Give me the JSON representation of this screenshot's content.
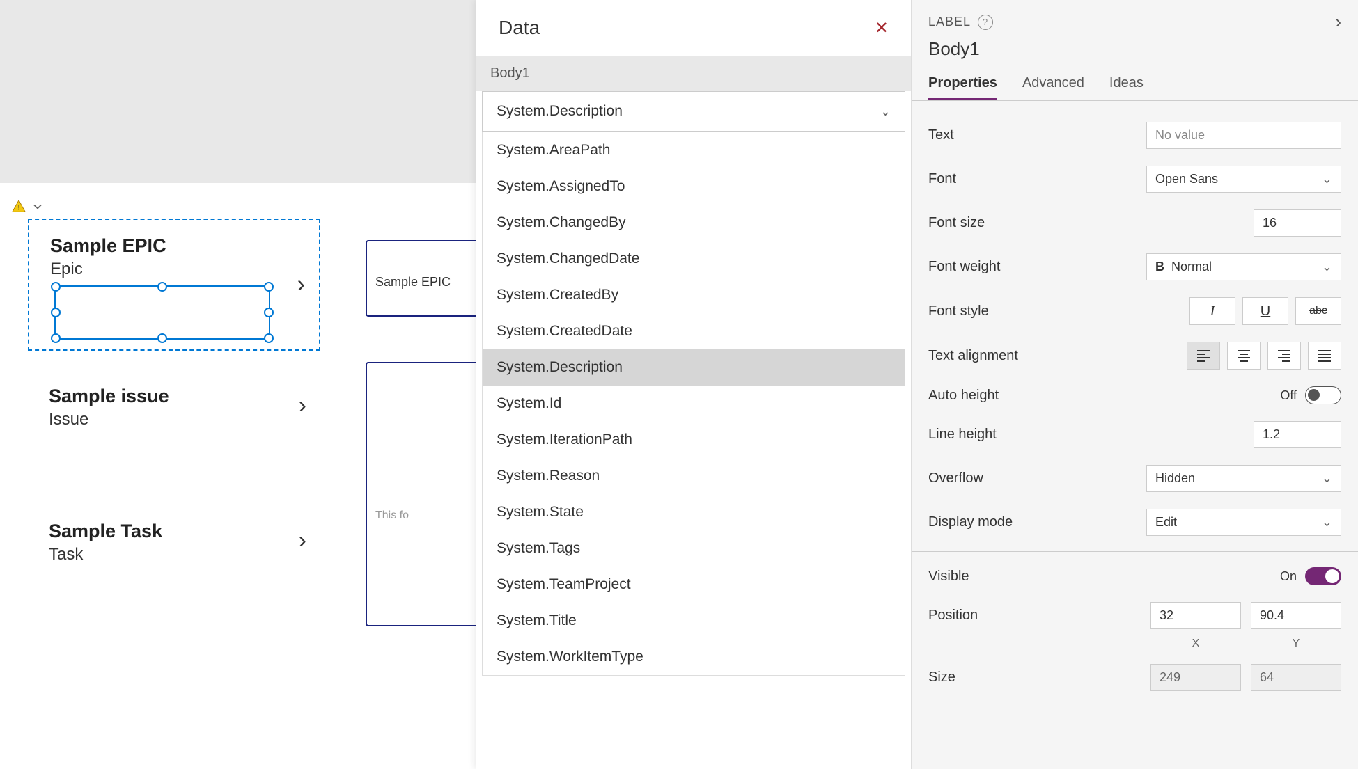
{
  "canvas": {
    "gallery": [
      {
        "title": "Sample EPIC",
        "subtitle": "Epic"
      },
      {
        "title": "Sample issue",
        "subtitle": "Issue"
      },
      {
        "title": "Sample Task",
        "subtitle": "Task"
      }
    ],
    "detail_title": "Sample EPIC",
    "detail_body_hint": "This fo"
  },
  "data_panel": {
    "title": "Data",
    "element_name": "Body1",
    "selected_value": "System.Description",
    "options": [
      "System.AreaPath",
      "System.AssignedTo",
      "System.ChangedBy",
      "System.ChangedDate",
      "System.CreatedBy",
      "System.CreatedDate",
      "System.Description",
      "System.Id",
      "System.IterationPath",
      "System.Reason",
      "System.State",
      "System.Tags",
      "System.TeamProject",
      "System.Title",
      "System.WorkItemType"
    ],
    "highlighted": "System.Description"
  },
  "props": {
    "label_caption": "LABEL",
    "element_name": "Body1",
    "tabs": [
      "Properties",
      "Advanced",
      "Ideas"
    ],
    "active_tab": "Properties",
    "text": {
      "label": "Text",
      "placeholder": "No value",
      "value": ""
    },
    "font": {
      "label": "Font",
      "value": "Open Sans"
    },
    "font_size": {
      "label": "Font size",
      "value": "16"
    },
    "font_weight": {
      "label": "Font weight",
      "value": "Normal"
    },
    "font_style": {
      "label": "Font style"
    },
    "text_alignment": {
      "label": "Text alignment",
      "active": "left"
    },
    "auto_height": {
      "label": "Auto height",
      "value_text": "Off",
      "on": false
    },
    "line_height": {
      "label": "Line height",
      "value": "1.2"
    },
    "overflow": {
      "label": "Overflow",
      "value": "Hidden"
    },
    "display_mode": {
      "label": "Display mode",
      "value": "Edit"
    },
    "visible": {
      "label": "Visible",
      "value_text": "On",
      "on": true
    },
    "position": {
      "label": "Position",
      "x": "32",
      "y": "90.4",
      "x_label": "X",
      "y_label": "Y"
    },
    "size": {
      "label": "Size",
      "w": "249",
      "h": "64"
    }
  }
}
